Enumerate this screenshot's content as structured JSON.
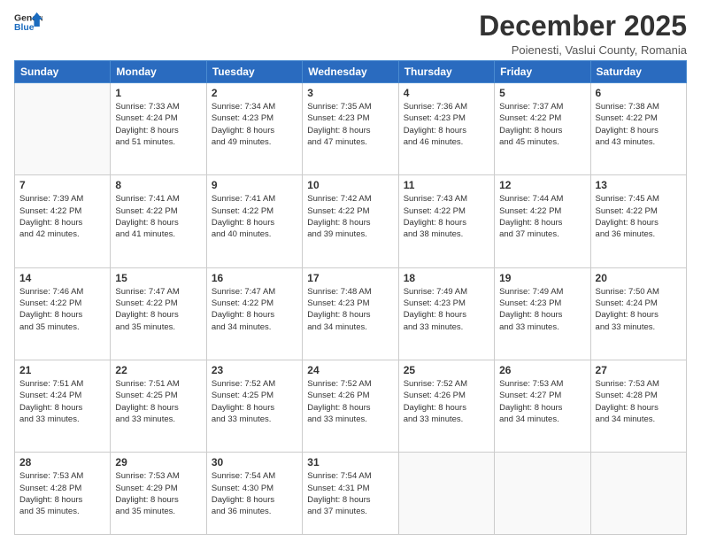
{
  "logo": {
    "line1": "General",
    "line2": "Blue"
  },
  "title": "December 2025",
  "location": "Poienesti, Vaslui County, Romania",
  "days_header": [
    "Sunday",
    "Monday",
    "Tuesday",
    "Wednesday",
    "Thursday",
    "Friday",
    "Saturday"
  ],
  "weeks": [
    [
      {
        "num": "",
        "info": ""
      },
      {
        "num": "1",
        "info": "Sunrise: 7:33 AM\nSunset: 4:24 PM\nDaylight: 8 hours\nand 51 minutes."
      },
      {
        "num": "2",
        "info": "Sunrise: 7:34 AM\nSunset: 4:23 PM\nDaylight: 8 hours\nand 49 minutes."
      },
      {
        "num": "3",
        "info": "Sunrise: 7:35 AM\nSunset: 4:23 PM\nDaylight: 8 hours\nand 47 minutes."
      },
      {
        "num": "4",
        "info": "Sunrise: 7:36 AM\nSunset: 4:23 PM\nDaylight: 8 hours\nand 46 minutes."
      },
      {
        "num": "5",
        "info": "Sunrise: 7:37 AM\nSunset: 4:22 PM\nDaylight: 8 hours\nand 45 minutes."
      },
      {
        "num": "6",
        "info": "Sunrise: 7:38 AM\nSunset: 4:22 PM\nDaylight: 8 hours\nand 43 minutes."
      }
    ],
    [
      {
        "num": "7",
        "info": "Sunrise: 7:39 AM\nSunset: 4:22 PM\nDaylight: 8 hours\nand 42 minutes."
      },
      {
        "num": "8",
        "info": "Sunrise: 7:41 AM\nSunset: 4:22 PM\nDaylight: 8 hours\nand 41 minutes."
      },
      {
        "num": "9",
        "info": "Sunrise: 7:41 AM\nSunset: 4:22 PM\nDaylight: 8 hours\nand 40 minutes."
      },
      {
        "num": "10",
        "info": "Sunrise: 7:42 AM\nSunset: 4:22 PM\nDaylight: 8 hours\nand 39 minutes."
      },
      {
        "num": "11",
        "info": "Sunrise: 7:43 AM\nSunset: 4:22 PM\nDaylight: 8 hours\nand 38 minutes."
      },
      {
        "num": "12",
        "info": "Sunrise: 7:44 AM\nSunset: 4:22 PM\nDaylight: 8 hours\nand 37 minutes."
      },
      {
        "num": "13",
        "info": "Sunrise: 7:45 AM\nSunset: 4:22 PM\nDaylight: 8 hours\nand 36 minutes."
      }
    ],
    [
      {
        "num": "14",
        "info": "Sunrise: 7:46 AM\nSunset: 4:22 PM\nDaylight: 8 hours\nand 35 minutes."
      },
      {
        "num": "15",
        "info": "Sunrise: 7:47 AM\nSunset: 4:22 PM\nDaylight: 8 hours\nand 35 minutes."
      },
      {
        "num": "16",
        "info": "Sunrise: 7:47 AM\nSunset: 4:22 PM\nDaylight: 8 hours\nand 34 minutes."
      },
      {
        "num": "17",
        "info": "Sunrise: 7:48 AM\nSunset: 4:23 PM\nDaylight: 8 hours\nand 34 minutes."
      },
      {
        "num": "18",
        "info": "Sunrise: 7:49 AM\nSunset: 4:23 PM\nDaylight: 8 hours\nand 33 minutes."
      },
      {
        "num": "19",
        "info": "Sunrise: 7:49 AM\nSunset: 4:23 PM\nDaylight: 8 hours\nand 33 minutes."
      },
      {
        "num": "20",
        "info": "Sunrise: 7:50 AM\nSunset: 4:24 PM\nDaylight: 8 hours\nand 33 minutes."
      }
    ],
    [
      {
        "num": "21",
        "info": "Sunrise: 7:51 AM\nSunset: 4:24 PM\nDaylight: 8 hours\nand 33 minutes."
      },
      {
        "num": "22",
        "info": "Sunrise: 7:51 AM\nSunset: 4:25 PM\nDaylight: 8 hours\nand 33 minutes."
      },
      {
        "num": "23",
        "info": "Sunrise: 7:52 AM\nSunset: 4:25 PM\nDaylight: 8 hours\nand 33 minutes."
      },
      {
        "num": "24",
        "info": "Sunrise: 7:52 AM\nSunset: 4:26 PM\nDaylight: 8 hours\nand 33 minutes."
      },
      {
        "num": "25",
        "info": "Sunrise: 7:52 AM\nSunset: 4:26 PM\nDaylight: 8 hours\nand 33 minutes."
      },
      {
        "num": "26",
        "info": "Sunrise: 7:53 AM\nSunset: 4:27 PM\nDaylight: 8 hours\nand 34 minutes."
      },
      {
        "num": "27",
        "info": "Sunrise: 7:53 AM\nSunset: 4:28 PM\nDaylight: 8 hours\nand 34 minutes."
      }
    ],
    [
      {
        "num": "28",
        "info": "Sunrise: 7:53 AM\nSunset: 4:28 PM\nDaylight: 8 hours\nand 35 minutes."
      },
      {
        "num": "29",
        "info": "Sunrise: 7:53 AM\nSunset: 4:29 PM\nDaylight: 8 hours\nand 35 minutes."
      },
      {
        "num": "30",
        "info": "Sunrise: 7:54 AM\nSunset: 4:30 PM\nDaylight: 8 hours\nand 36 minutes."
      },
      {
        "num": "31",
        "info": "Sunrise: 7:54 AM\nSunset: 4:31 PM\nDaylight: 8 hours\nand 37 minutes."
      },
      {
        "num": "",
        "info": ""
      },
      {
        "num": "",
        "info": ""
      },
      {
        "num": "",
        "info": ""
      }
    ]
  ]
}
